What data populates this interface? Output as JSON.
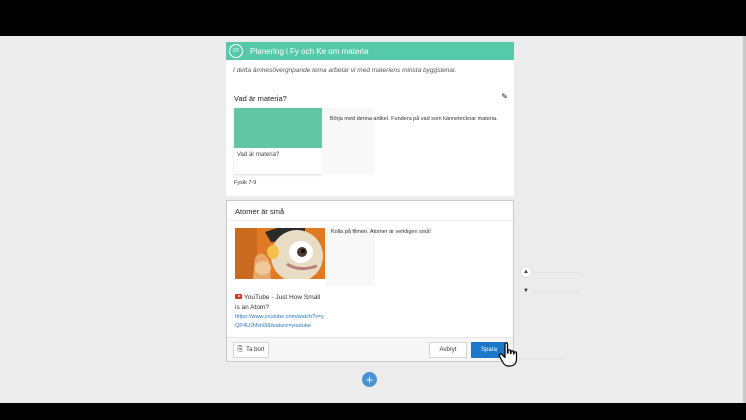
{
  "header": {
    "badge": "CF",
    "title": "Planering i Fy och Ke om materia",
    "description": "I detta ämnesövergripande tema arbetar vi med materiens minsta byggstenar."
  },
  "card1": {
    "title": "Vad är materia?",
    "thumb_caption": "Vad är materia?",
    "text": "Börja med denna artikel. Fundera på vad som kännetecknar materia.",
    "meta": "Fysik 7-9",
    "thumb_color": "#62c6a5"
  },
  "card2": {
    "title": "Atomer är små",
    "text": "Kolla på filmen. Atomer är verkligen små!",
    "youtube_title": "YouTube - Just How Small is an Atom?",
    "youtube_url": "https://www.youtube.com/watch?v=yQP4UJhNn0I&feature=youtube",
    "delete_label": "Ta bort",
    "cancel_label": "Avbryt",
    "save_label": "Spara"
  },
  "add_label": "+",
  "colors": {
    "accent_green": "#55c9a8",
    "primary_blue": "#1b78c8",
    "add_blue": "#4a93d6"
  },
  "icons": [
    "pencil-icon",
    "paperclip-icon",
    "youtube-icon",
    "plus-icon",
    "chevron-up-icon",
    "chevron-down-icon",
    "hand-cursor-icon"
  ]
}
